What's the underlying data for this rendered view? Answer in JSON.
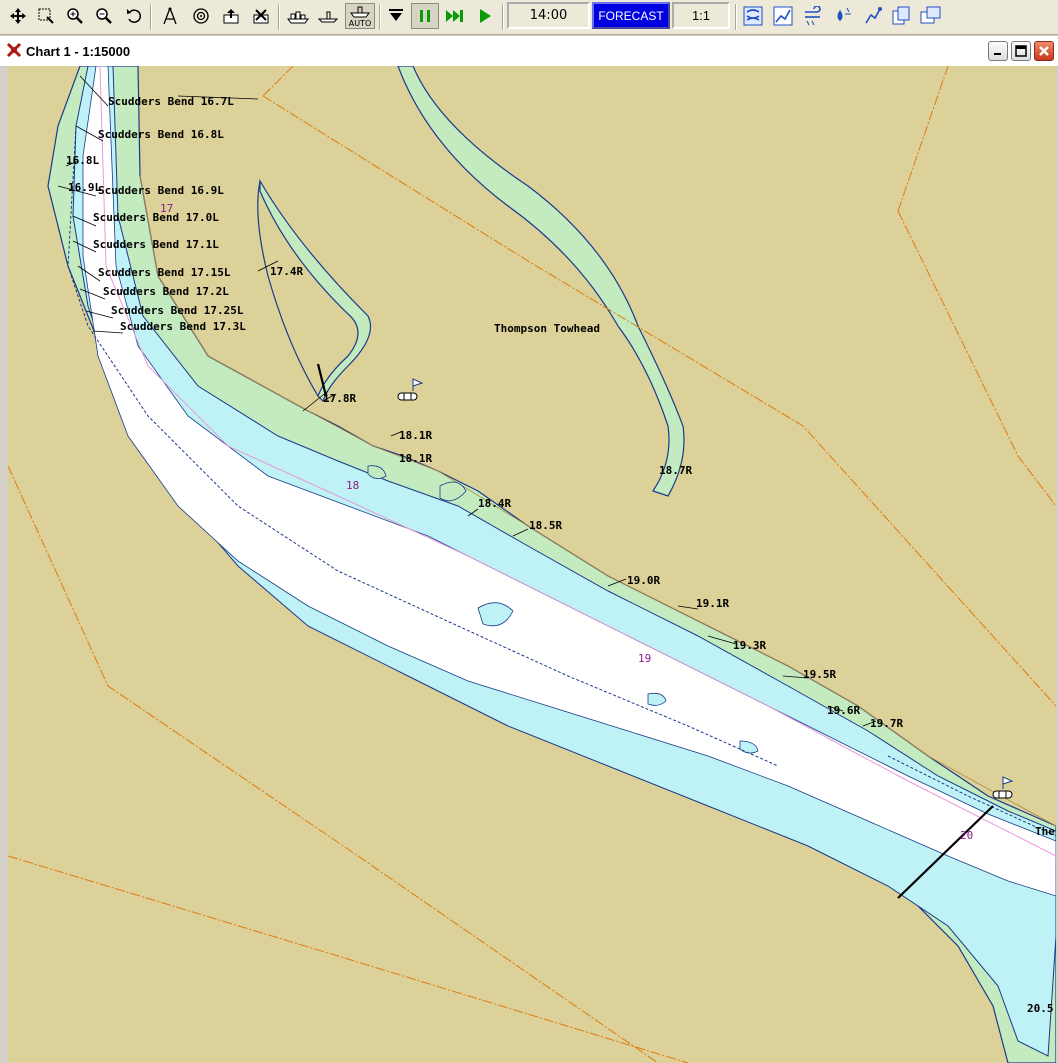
{
  "toolbar": {
    "icons": [
      "pan-icon",
      "zoom-window-icon",
      "zoom-in-icon",
      "zoom-out-icon",
      "undo-icon",
      "compass-icon",
      "target-icon",
      "export-icon",
      "layers-icon",
      "vessel-icon",
      "boat-icon",
      "auto-icon",
      "arrow-down-icon",
      "pause-icon",
      "fast-forward-icon",
      "play-icon",
      "weather-icon",
      "graph-icon",
      "wind-icon",
      "water-icon",
      "route-icon",
      "copy-icon",
      "window-icon"
    ],
    "auto_label": "AUTO",
    "time": "14:00",
    "forecast_label": "FORECAST",
    "scale": "1:1"
  },
  "window": {
    "title": "Chart 1 - 1:15000"
  },
  "colors": {
    "land": "#dcd199",
    "shoal": "#c4ebc0",
    "shallow": "#bff2f6",
    "channel": "#ffffff",
    "mile_label": "#8a1a8a",
    "forecast": "#0000e0"
  },
  "chart": {
    "place": "Thompson Towhead",
    "labels": [
      "Scudders Bend 16.7L",
      "Scudders Bend 16.8L",
      "16.8L",
      "16.9L",
      "Scudders Bend 16.9L",
      "Scudders Bend 17.0L",
      "Scudders Bend 17.1L",
      "Scudders Bend 17.15L",
      "17.4R",
      "Scudders Bend 17.2L",
      "Scudders Bend 17.25L",
      "Scudders Bend 17.3L",
      "17.8R",
      "18.1R",
      "18.1R",
      "18.7R",
      "18.4R",
      "18.5R",
      "19.0R",
      "19.1R",
      "19.3R",
      "19.5R",
      "19.6R",
      "19.7R",
      "20.5",
      "The"
    ],
    "river_miles": [
      "17",
      "18",
      "19",
      "20"
    ]
  }
}
